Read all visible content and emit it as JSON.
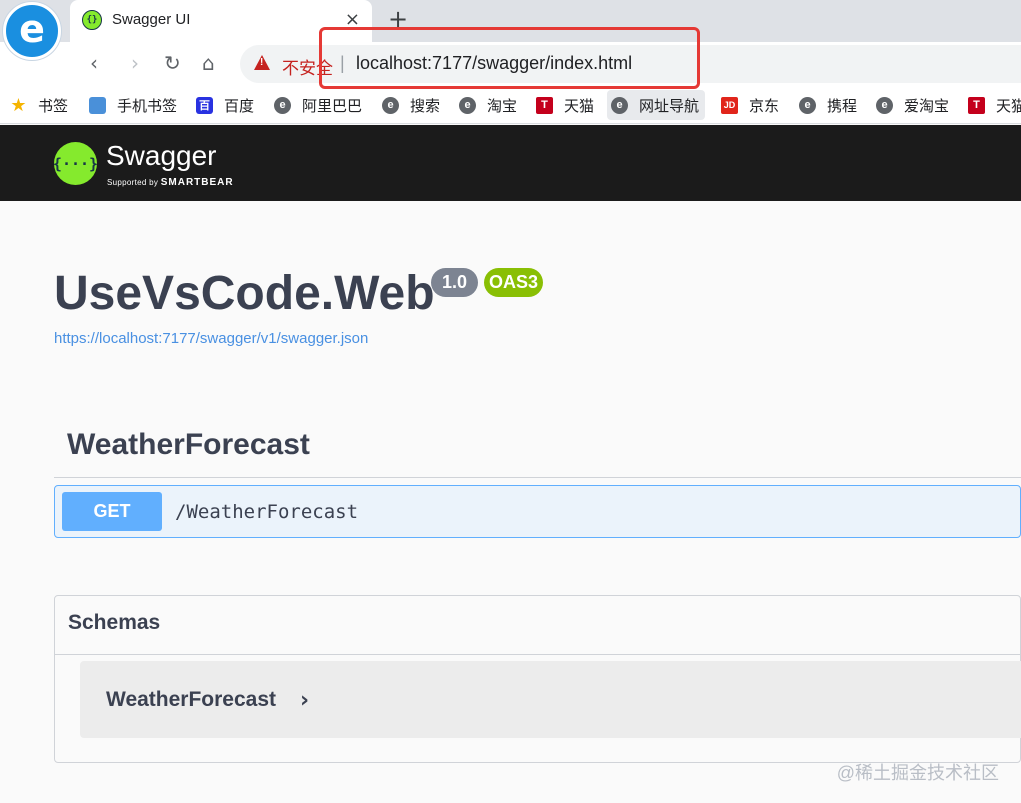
{
  "browser": {
    "tab_title": "Swagger UI",
    "tab_close": "×",
    "new_tab": "+",
    "security_label": "不安全",
    "separator": "|",
    "url": "localhost:7177/swagger/index.html",
    "nav": {
      "back": "‹",
      "forward": "›",
      "reload": "↻",
      "home": "⌂"
    },
    "bookmarks": [
      {
        "label": "书签",
        "icon": "star-icon",
        "glyph": "★"
      },
      {
        "label": "手机书签",
        "icon": "phone-icon",
        "glyph": ""
      },
      {
        "label": "百度",
        "icon": "baidu-icon",
        "glyph": "百"
      },
      {
        "label": "阿里巴巴",
        "icon": "e-icon",
        "glyph": "e"
      },
      {
        "label": "搜索",
        "icon": "e-icon",
        "glyph": "e"
      },
      {
        "label": "淘宝",
        "icon": "e-icon",
        "glyph": "e"
      },
      {
        "label": "天猫",
        "icon": "tmall-icon",
        "glyph": "T"
      },
      {
        "label": "网址导航",
        "icon": "e-icon",
        "glyph": "e"
      },
      {
        "label": "京东",
        "icon": "jd-icon",
        "glyph": "JD"
      },
      {
        "label": "携程",
        "icon": "e-icon",
        "glyph": "e"
      },
      {
        "label": "爱淘宝",
        "icon": "e-icon",
        "glyph": "e"
      },
      {
        "label": "天猫",
        "icon": "tmall-icon",
        "glyph": "T"
      }
    ]
  },
  "topbar": {
    "brand": "Swagger",
    "logo_glyph": "{···}",
    "supported_by": "Supported by",
    "company": "SMARTBEAR"
  },
  "info": {
    "title": "UseVsCode.Web",
    "version": "1.0",
    "oas": "OAS3",
    "spec_url": "https://localhost:7177/swagger/v1/swagger.json"
  },
  "tag": {
    "name": "WeatherForecast",
    "operations": [
      {
        "method": "GET",
        "path": "/WeatherForecast"
      }
    ]
  },
  "schemas": {
    "title": "Schemas",
    "models": [
      {
        "name": "WeatherForecast",
        "arrow": "›"
      }
    ]
  },
  "watermark": "@稀土掘金技术社区",
  "colors": {
    "get": "#61affe",
    "oas_badge": "#89bf04",
    "version_badge": "#7d8492",
    "topbar": "#1b1b1b",
    "swagger_green": "#85ea2d",
    "highlight": "#e53935"
  }
}
